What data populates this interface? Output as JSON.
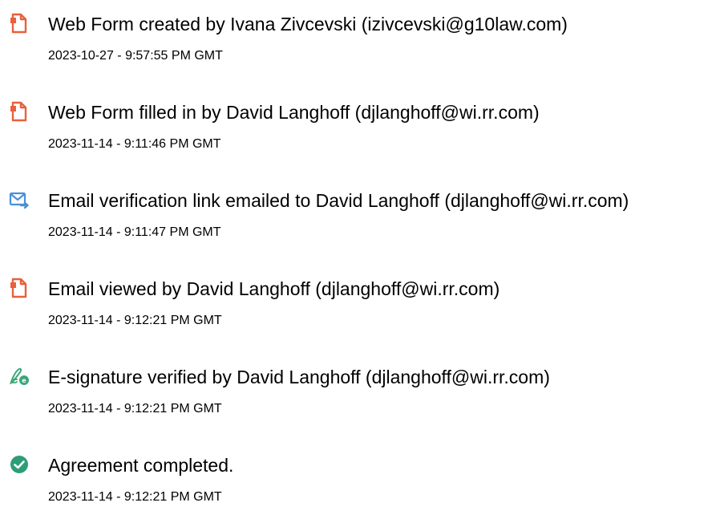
{
  "events": [
    {
      "icon": "document-icon",
      "title": "Web Form created by Ivana Zivcevski (izivcevski@g10law.com)",
      "timestamp": "2023-10-27 - 9:57:55 PM GMT"
    },
    {
      "icon": "document-icon",
      "title": "Web Form filled in by David Langhoff (djlanghoff@wi.rr.com)",
      "timestamp": "2023-11-14 - 9:11:46 PM GMT"
    },
    {
      "icon": "email-send-icon",
      "title": "Email verification link emailed to David Langhoff (djlanghoff@wi.rr.com)",
      "timestamp": "2023-11-14 - 9:11:47 PM GMT"
    },
    {
      "icon": "document-icon",
      "title": "Email viewed by David Langhoff (djlanghoff@wi.rr.com)",
      "timestamp": "2023-11-14 - 9:12:21 PM GMT"
    },
    {
      "icon": "e-signature-icon",
      "title": "E-signature verified by David Langhoff (djlanghoff@wi.rr.com)",
      "timestamp": "2023-11-14 - 9:12:21 PM GMT"
    },
    {
      "icon": "check-circle-icon",
      "title": "Agreement completed.",
      "timestamp": "2023-11-14 - 9:12:21 PM GMT"
    }
  ],
  "colors": {
    "document_icon": "#e8603c",
    "email_icon": "#4a90d9",
    "signature_icon": "#3aa77a",
    "check_icon": "#2d9d78",
    "text": "#000000"
  }
}
